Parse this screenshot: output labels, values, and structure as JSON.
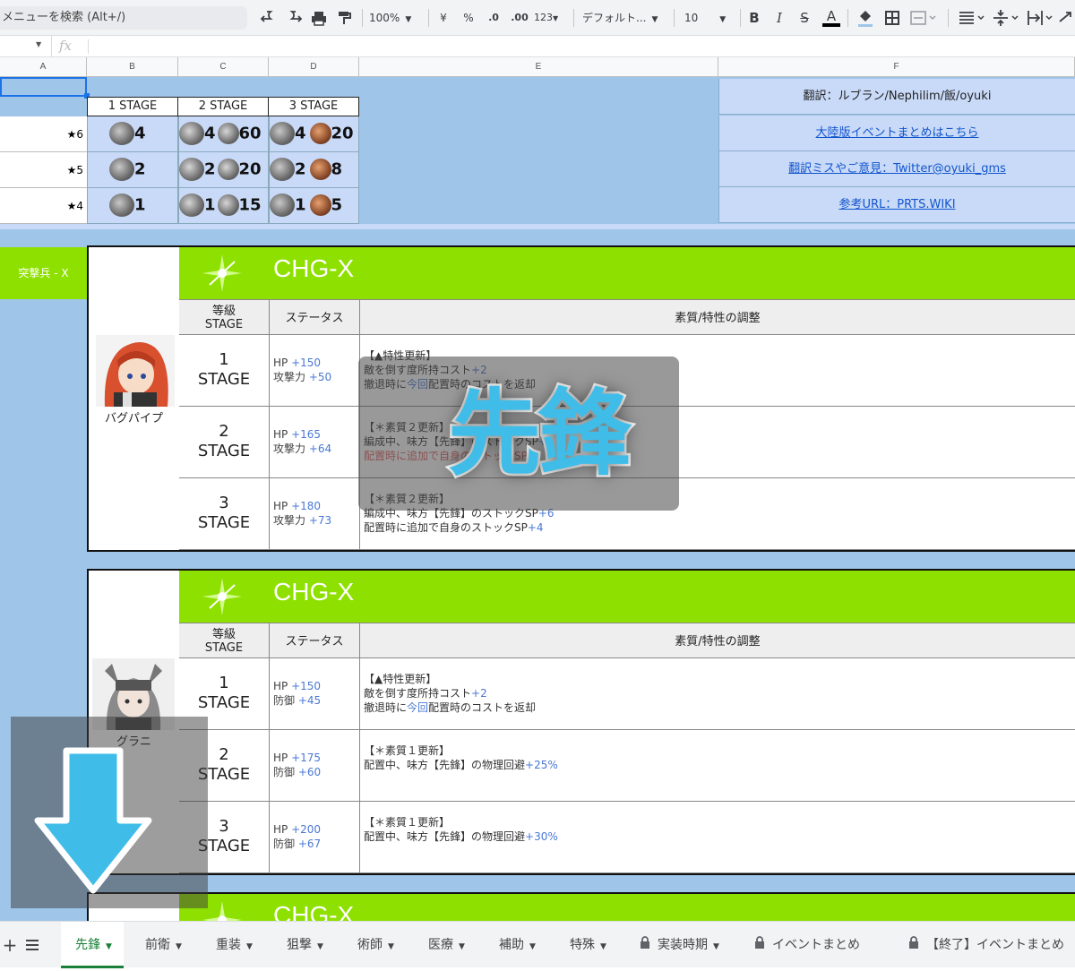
{
  "toolbar": {
    "menu_search": "メニューを検索 (Alt+/)",
    "zoom": "100%",
    "currency": "¥",
    "percent": "%",
    "dec_less": ".0",
    "dec_more": ".00",
    "format_more": "123",
    "font": "デフォルト...",
    "font_size": "10",
    "bold": "B",
    "italic": "I",
    "strike": "S",
    "text_color": "A"
  },
  "formula_bar": {
    "fx": "fx"
  },
  "columns": [
    "A",
    "B",
    "C",
    "D",
    "E",
    "F"
  ],
  "reward_table": {
    "headers": [
      "1 STAGE",
      "2 STAGE",
      "3 STAGE"
    ],
    "rows": [
      {
        "rank": "★6",
        "b": "4",
        "c1": "4",
        "c2": "60",
        "d1": "4",
        "d2": "20"
      },
      {
        "rank": "★5",
        "b": "2",
        "c1": "2",
        "c2": "20",
        "d1": "2",
        "d2": "8"
      },
      {
        "rank": "★4",
        "b": "1",
        "c1": "1",
        "c2": "15",
        "d1": "1",
        "d2": "5"
      }
    ]
  },
  "info_links": [
    {
      "text": "翻訳：ルブラン/Nephilim/飯/oyuki",
      "link": false
    },
    {
      "text": "大陸版イベントまとめはこちら",
      "link": true
    },
    {
      "text": "翻訳ミスやご意見：Twitter@oyuki_gms",
      "link": true
    },
    {
      "text": "参考URL：PRTS.WIKI",
      "link": true
    }
  ],
  "section_label": "突撃兵 - X",
  "overlay_badge": "先鋒",
  "cards": [
    {
      "title": "CHG-X",
      "header": {
        "grade": "等級",
        "grade2": "STAGE",
        "status": "ステータス",
        "desc": "素質/特性の調整"
      },
      "operator": "バグパイプ",
      "rows": [
        {
          "stage_num": "1",
          "stage": "STAGE",
          "hp_label": "HP",
          "hp": "+150",
          "stat_label": "攻撃力",
          "stat": "+50",
          "l1": "【▲特性更新】",
          "l2a": "敵を倒す度所持コスト",
          "l2b": "+2",
          "l3a": "撤退時に",
          "l3b": "今回",
          "l3c": "配置時のコストを返却"
        },
        {
          "stage_num": "2",
          "stage": "STAGE",
          "hp_label": "HP",
          "hp": "+165",
          "stat_label": "攻撃力",
          "stat": "+64",
          "l1": "【＊素質２更新】",
          "l2a": "編成中、味方【先鋒】のストックSP",
          "l2b": "+4",
          "l3a": "配置時に追加で",
          "l3b": "",
          "l3c": "自身のストックSP"
        },
        {
          "stage_num": "3",
          "stage": "STAGE",
          "hp_label": "HP",
          "hp": "+180",
          "stat_label": "攻撃力",
          "stat": "+73",
          "l1": "【＊素質２更新】",
          "l2a": "編成中、味方【先鋒】のストックSP",
          "l2b": "+6",
          "l3a": "配置時に追加で自身のストックSP",
          "l3b": "+4",
          "l3c": ""
        }
      ]
    },
    {
      "title": "CHG-X",
      "header": {
        "grade": "等級",
        "grade2": "STAGE",
        "status": "ステータス",
        "desc": "素質/特性の調整"
      },
      "operator": "グラニ",
      "rows": [
        {
          "stage_num": "1",
          "stage": "STAGE",
          "hp_label": "HP",
          "hp": "+150",
          "stat_label": "防御",
          "stat": "+45",
          "l1": "【▲特性更新】",
          "l2a": "敵を倒す度所持コスト",
          "l2b": "+2",
          "l3a": "撤退時に",
          "l3b": "今回",
          "l3c": "配置時のコストを返却"
        },
        {
          "stage_num": "2",
          "stage": "STAGE",
          "hp_label": "HP",
          "hp": "+175",
          "stat_label": "防御",
          "stat": "+60",
          "l1": "【＊素質１更新】",
          "l2a": "配置中、味方【先鋒】の物理回避",
          "l2b": "+25%",
          "l3a": "",
          "l3b": "",
          "l3c": ""
        },
        {
          "stage_num": "3",
          "stage": "STAGE",
          "hp_label": "HP",
          "hp": "+200",
          "stat_label": "防御",
          "stat": "+67",
          "l1": "【＊素質１更新】",
          "l2a": "配置中、味方【先鋒】の物理回避",
          "l2b": "+30%",
          "l3a": "",
          "l3b": "",
          "l3c": ""
        }
      ]
    },
    {
      "title": "CHG-X"
    }
  ],
  "tabs": [
    {
      "label": "先鋒",
      "active": true,
      "locked": false
    },
    {
      "label": "前衛",
      "active": false,
      "locked": false
    },
    {
      "label": "重装",
      "active": false,
      "locked": false
    },
    {
      "label": "狙撃",
      "active": false,
      "locked": false
    },
    {
      "label": "術師",
      "active": false,
      "locked": false
    },
    {
      "label": "医療",
      "active": false,
      "locked": false
    },
    {
      "label": "補助",
      "active": false,
      "locked": false
    },
    {
      "label": "特殊",
      "active": false,
      "locked": false
    },
    {
      "label": "実装時期",
      "active": false,
      "locked": true
    },
    {
      "label": "イベントまとめ",
      "active": false,
      "locked": true
    },
    {
      "label": "【終了】イベントまとめ",
      "active": false,
      "locked": true
    }
  ],
  "colors": {
    "accent_green": "#8ee000",
    "sheet_blue": "#9fc5e8",
    "badge_blue": "#3fbde8",
    "tab_active": "#188038"
  }
}
